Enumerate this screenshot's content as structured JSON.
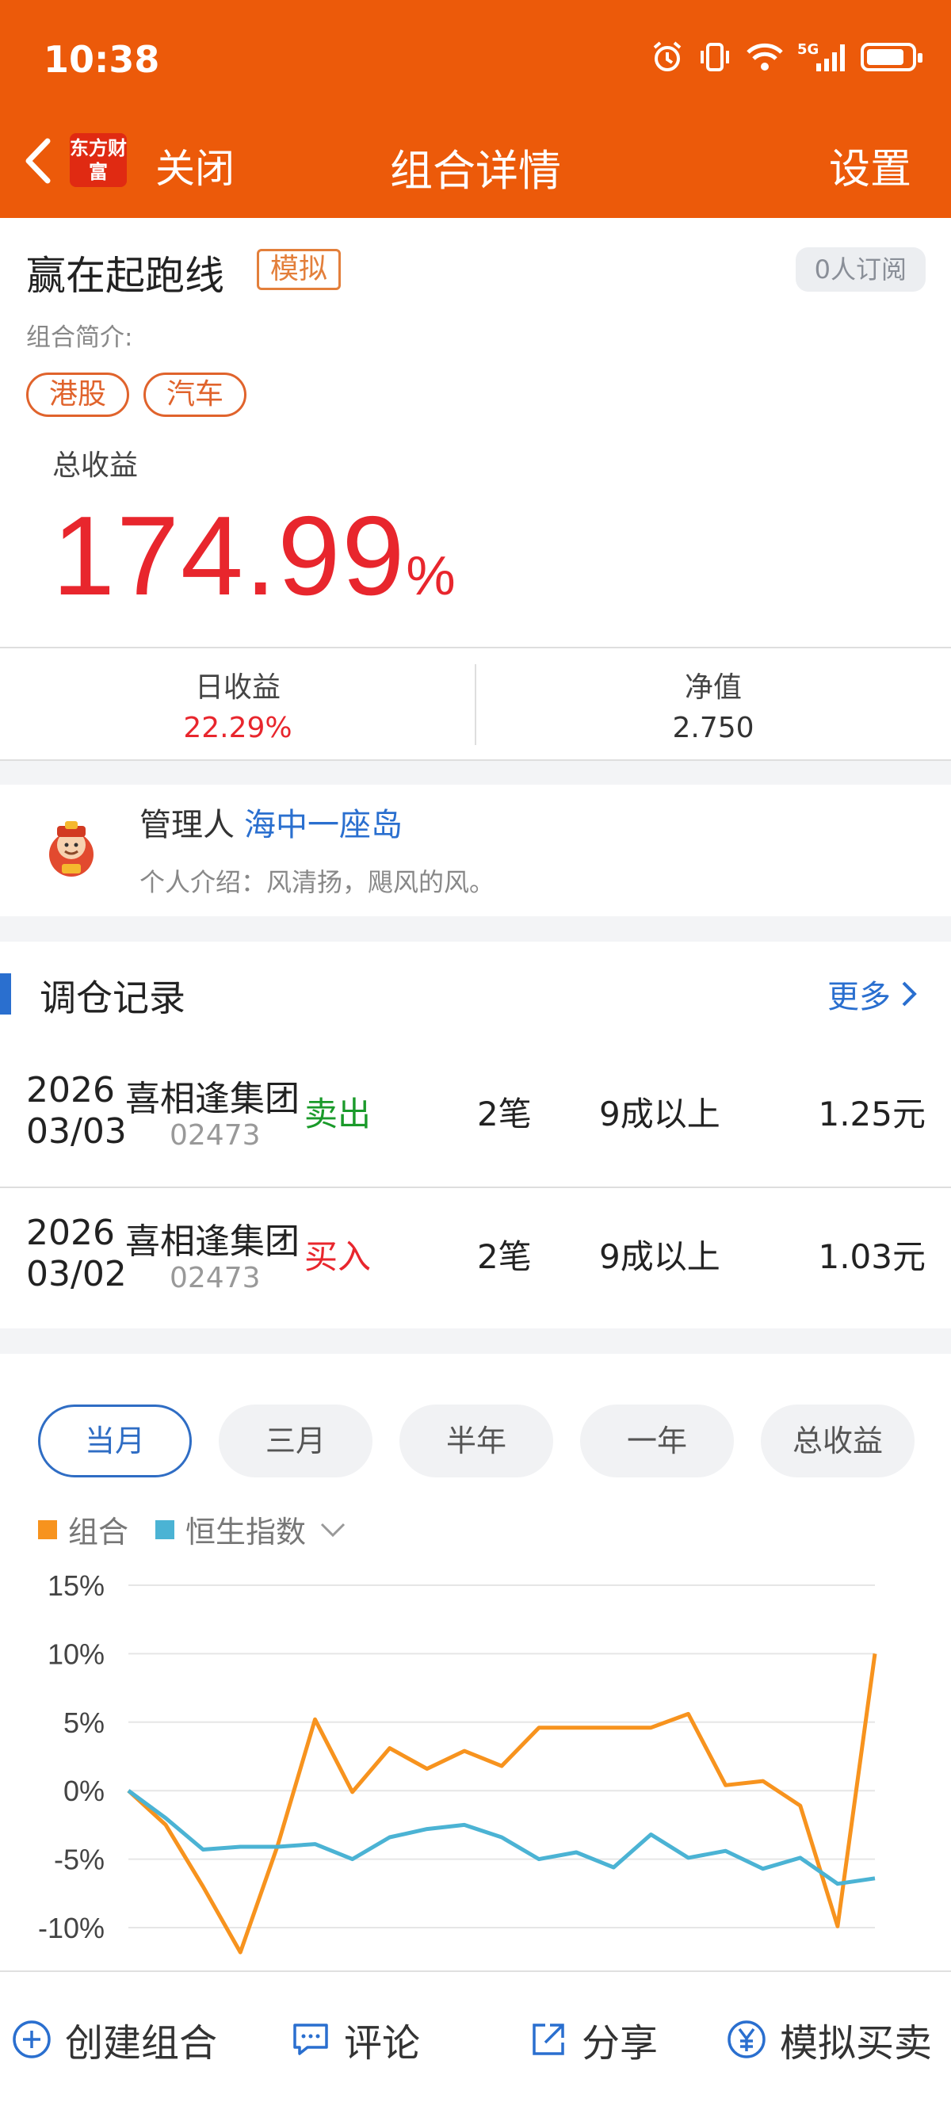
{
  "status_bar": {
    "time": "10:38",
    "icons": [
      "alarm-icon",
      "vibrate-icon",
      "wifi-icon",
      "signal-5g-icon",
      "battery-icon"
    ],
    "network_label": "5G",
    "battery_level": 0.85
  },
  "nav": {
    "back_icon": "chevron-left-icon",
    "logo_text": "东方财富",
    "close_label": "关闭",
    "title": "组合详情",
    "settings_label": "设置"
  },
  "portfolio": {
    "name": "赢在起跑线",
    "badge": "模拟",
    "subscribers": "0人订阅",
    "intro_label": "组合简介:",
    "tags": [
      "港股",
      "汽车"
    ],
    "total_return_label": "总收益",
    "total_return_value": "174.99",
    "total_return_unit": "%",
    "daily_return_label": "日收益",
    "daily_return_value": "22.29%",
    "nav_label": "净值",
    "nav_value": "2.750"
  },
  "manager": {
    "label": "管理人",
    "name": "海中一座岛",
    "intro": "个人介绍：风清扬，飓风的风。"
  },
  "trades": {
    "title": "调仓记录",
    "more_label": "更多",
    "rows": [
      {
        "year": "2026",
        "date": "03/03",
        "stock": "喜相逢集团",
        "code": "02473",
        "action": "卖出",
        "count": "2笔",
        "position": "9成以上",
        "price": "1.25元"
      },
      {
        "year": "2026",
        "date": "03/02",
        "stock": "喜相逢集团",
        "code": "02473",
        "action": "买入",
        "count": "2笔",
        "position": "9成以上",
        "price": "1.03元"
      }
    ]
  },
  "period_tabs": [
    "当月",
    "三月",
    "半年",
    "一年",
    "总收益"
  ],
  "active_tab": 0,
  "legend": {
    "series1": "组合",
    "series2": "恒生指数"
  },
  "colors": {
    "brand_orange": "#ec5a0a",
    "up_red": "#e8262d",
    "down_green": "#1a9a2a",
    "link_blue": "#2a6fcf",
    "series1": "#f7931e",
    "series2": "#4bb3d4"
  },
  "chart_data": {
    "type": "line",
    "y_tick_labels": [
      "15%",
      "10%",
      "5%",
      "0%",
      "-5%",
      "-10%"
    ],
    "ylim": [
      -12,
      15
    ],
    "grid": true,
    "series": [
      {
        "name": "组合",
        "values": [
          0,
          -2.5,
          -7,
          -11.8,
          -4,
          5.2,
          -0.1,
          3.1,
          1.6,
          2.9,
          1.8,
          4.6,
          4.6,
          4.6,
          4.6,
          5.6,
          0.4,
          0.7,
          -1.1,
          -9.9,
          10
        ]
      },
      {
        "name": "恒生指数",
        "values": [
          0,
          -2,
          -4.3,
          -4.1,
          -4.1,
          -3.9,
          -5,
          -3.4,
          -2.8,
          -2.5,
          -3.4,
          -5,
          -4.5,
          -5.6,
          -3.2,
          -4.9,
          -4.4,
          -5.7,
          -4.9,
          -6.8,
          -6.4
        ]
      }
    ]
  },
  "bottom_bar": [
    {
      "label": "创建组合",
      "icon": "plus-circle-icon"
    },
    {
      "label": "评论",
      "icon": "comment-icon"
    },
    {
      "label": "分享",
      "icon": "share-icon"
    },
    {
      "label": "模拟买卖",
      "icon": "yen-circle-icon"
    }
  ]
}
